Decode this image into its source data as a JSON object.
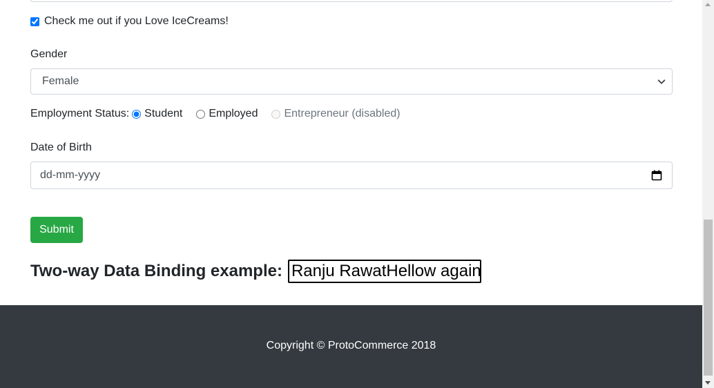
{
  "form": {
    "icecream_checkbox": {
      "label": "Check me out if you Love IceCreams!",
      "checked": true
    },
    "gender": {
      "label": "Gender",
      "selected": "Female"
    },
    "employment": {
      "label": "Employment Status:",
      "options": [
        {
          "label": "Student",
          "checked": true,
          "disabled": false
        },
        {
          "label": "Employed",
          "checked": false,
          "disabled": false
        },
        {
          "label": "Entrepreneur (disabled)",
          "checked": false,
          "disabled": true
        }
      ]
    },
    "dob": {
      "label": "Date of Birth",
      "placeholder": "dd-mm-yyyy"
    },
    "submit_label": "Submit"
  },
  "binding": {
    "heading": "Two-way Data Binding example:",
    "value": "Ranju RawatHellow again"
  },
  "footer": {
    "copyright": "Copyright © ProtoCommerce 2018"
  },
  "colors": {
    "submit_bg": "#28a745",
    "footer_bg": "#343a40",
    "radio_accent": "#0075ff"
  }
}
